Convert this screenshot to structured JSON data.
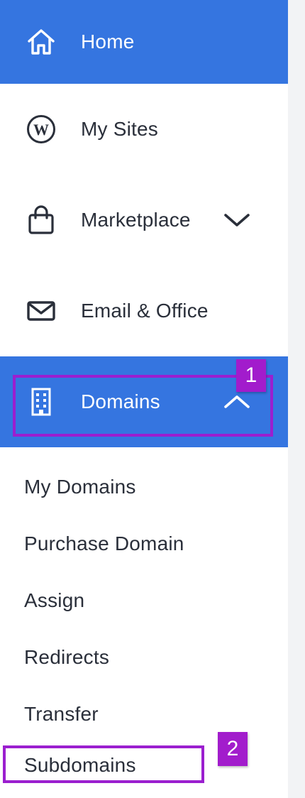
{
  "nav": {
    "home": {
      "label": "Home",
      "icon": "home-icon"
    },
    "my_sites": {
      "label": "My Sites",
      "icon": "wordpress-icon"
    },
    "marketplace": {
      "label": "Marketplace",
      "icon": "shopping-bag-icon",
      "chevron": "chevron-down-icon"
    },
    "email_office": {
      "label": "Email & Office",
      "icon": "envelope-icon"
    },
    "domains": {
      "label": "Domains",
      "icon": "building-icon",
      "chevron": "chevron-up-icon"
    }
  },
  "domains_submenu": [
    {
      "label": "My Domains"
    },
    {
      "label": "Purchase Domain"
    },
    {
      "label": "Assign"
    },
    {
      "label": "Redirects"
    },
    {
      "label": "Transfer"
    },
    {
      "label": "Subdomains"
    }
  ],
  "annotations": [
    {
      "label": "1"
    },
    {
      "label": "2"
    }
  ],
  "colors": {
    "accent": "#3575e0",
    "text": "#2a2f3a",
    "annotation": "#a21ccc"
  }
}
